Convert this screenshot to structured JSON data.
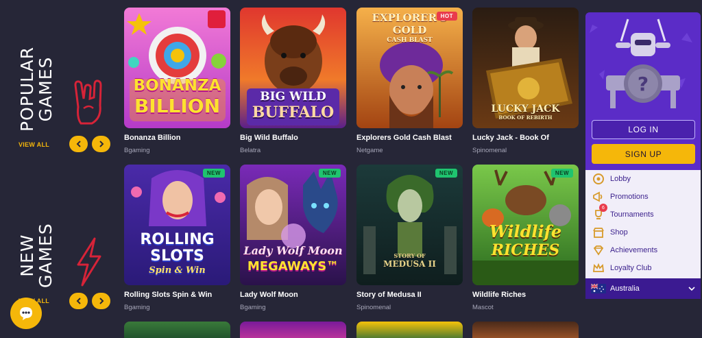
{
  "sections": {
    "popular": {
      "title_line1": "POPULAR",
      "title_line2": "GAMES",
      "view_all": "VIEW ALL"
    },
    "new": {
      "title_line1": "NEW",
      "title_line2": "GAMES",
      "view_all": "VIEW ALL"
    }
  },
  "popular_games": [
    {
      "name": "Bonanza Billion",
      "provider": "Bgaming",
      "art_line1": "BONANZA",
      "art_line2": "BILLION"
    },
    {
      "name": "Big Wild Buffalo",
      "provider": "Belatra",
      "art_line1": "BIG WILD",
      "art_line2": "BUFFALO"
    },
    {
      "name": "Explorers Gold Cash Blast",
      "provider": "Netgame",
      "badge": "HOT",
      "art_line1": "EXPLORER'S GOLD",
      "art_line2": "CASH BLAST"
    },
    {
      "name": "Lucky Jack - Book Of",
      "provider": "Spinomenal",
      "art_line1": "LUCKY JACK",
      "art_line2": "BOOK OF REBIRTH"
    }
  ],
  "new_games": [
    {
      "name": "Rolling Slots Spin & Win",
      "provider": "Bgaming",
      "badge": "NEW",
      "art_line1": "ROLLING",
      "art_line2": "SLOTS",
      "art_line3": "Spin & Win"
    },
    {
      "name": "Lady Wolf Moon",
      "provider": "Bgaming",
      "badge": "NEW",
      "art_line1": "Lady Wolf Moon",
      "art_line2": "MEGAWAYS™"
    },
    {
      "name": "Story of Medusa II",
      "provider": "Spinomenal",
      "badge": "NEW",
      "art_line1": "STORY OF",
      "art_line2": "MEDUSA II"
    },
    {
      "name": "Wildlife Riches",
      "provider": "Mascot",
      "badge": "NEW",
      "art_line1": "Wildlife",
      "art_line2": "RICHES"
    }
  ],
  "sidebar": {
    "login": "LOG IN",
    "signup": "SIGN UP",
    "menu": [
      {
        "label": "Lobby",
        "icon": "lobby-icon"
      },
      {
        "label": "Promotions",
        "icon": "megaphone-icon"
      },
      {
        "label": "Tournaments",
        "icon": "trophy-icon",
        "count": "6"
      },
      {
        "label": "Shop",
        "icon": "shop-icon"
      },
      {
        "label": "Achievements",
        "icon": "diamond-icon"
      },
      {
        "label": "Loyalty Club",
        "icon": "crown-icon"
      }
    ],
    "country": "Australia"
  },
  "colors": {
    "background": "#262637",
    "accent": "#f5b70a",
    "purple": "#5b2cc7",
    "new_badge": "#1fc46f",
    "hot_badge": "#e93b4c"
  }
}
